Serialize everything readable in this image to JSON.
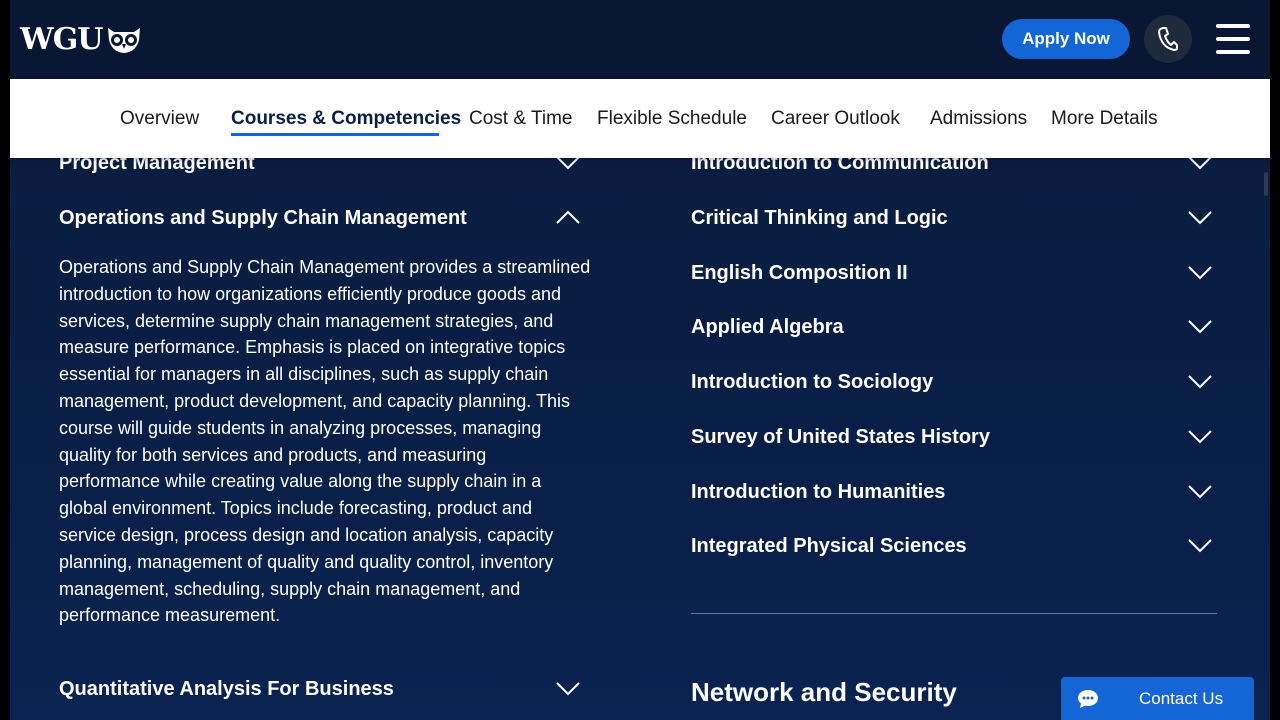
{
  "header": {
    "logo_text": "WGU",
    "apply_label": "Apply Now"
  },
  "subnav": {
    "items": [
      {
        "label": "Overview"
      },
      {
        "label": "Courses & Competencies",
        "active": true
      },
      {
        "label": "Cost & Time"
      },
      {
        "label": "Flexible Schedule"
      },
      {
        "label": "Career Outlook"
      },
      {
        "label": "Admissions"
      },
      {
        "label": "More Details"
      }
    ]
  },
  "left_column": {
    "items": [
      {
        "title": "Project Management",
        "expanded": false
      },
      {
        "title": "Operations and Supply Chain Management",
        "expanded": true
      },
      {
        "title": "Quantitative Analysis For Business",
        "expanded": false
      }
    ],
    "expanded_description": "Operations and Supply Chain Management provides a streamlined introduction to how organizations efficiently produce goods and services, determine supply chain management strategies, and measure performance. Emphasis is placed on integrative topics essential for managers in all disciplines, such as supply chain management, product development, and capacity planning. This course will guide students in analyzing processes, managing quality for both services and products, and measuring performance while creating value along the supply chain in a global environment. Topics include forecasting, product and service design, process design and location analysis, capacity planning, management of quality and quality control, inventory management, scheduling, supply chain management, and performance measurement."
  },
  "right_column": {
    "items": [
      {
        "title": "Introduction to Communication"
      },
      {
        "title": "Critical Thinking and Logic"
      },
      {
        "title": "English Composition II"
      },
      {
        "title": "Applied Algebra"
      },
      {
        "title": "Introduction to Sociology"
      },
      {
        "title": "Survey of United States History"
      },
      {
        "title": "Introduction to Humanities"
      },
      {
        "title": "Integrated Physical Sciences"
      }
    ],
    "section_heading": "Network and Security"
  },
  "contact": {
    "label": "Contact Us"
  },
  "colors": {
    "accent": "#1466d6",
    "background": "#0b1c3d"
  }
}
